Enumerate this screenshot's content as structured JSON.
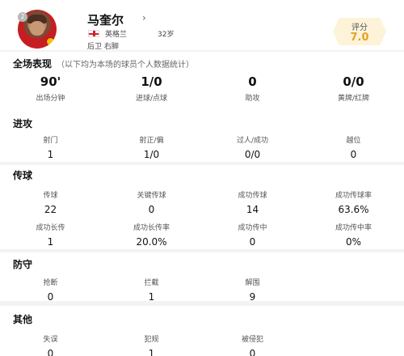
{
  "player": {
    "number": "2",
    "name": "马奎尔",
    "chevron": "›",
    "country": "英格兰",
    "age": "32岁",
    "position": "后卫  右脚",
    "rating_label": "评分",
    "rating_value": "7.0"
  },
  "summary": {
    "title": "全场表现",
    "note": "（以下均为本场的球员个人数据统计）",
    "items": [
      {
        "value": "90'",
        "label": "出场分钟"
      },
      {
        "value": "1/0",
        "label": "进球/点球"
      },
      {
        "value": "0",
        "label": "助攻"
      },
      {
        "value": "0/0",
        "label": "黄牌/红牌"
      }
    ]
  },
  "attack": {
    "title": "进攻",
    "items": [
      {
        "label": "射门",
        "value": "1"
      },
      {
        "label": "射正/偏",
        "value": "1/0"
      },
      {
        "label": "过人/成功",
        "value": "0/0"
      },
      {
        "label": "越位",
        "value": "0"
      }
    ]
  },
  "passing": {
    "title": "传球",
    "row1": [
      {
        "label": "传球",
        "value": "22"
      },
      {
        "label": "关键传球",
        "value": "0"
      },
      {
        "label": "成功传球",
        "value": "14"
      },
      {
        "label": "成功传球率",
        "value": "63.6%"
      }
    ],
    "row2": [
      {
        "label": "成功长传",
        "value": "1"
      },
      {
        "label": "成功长传率",
        "value": "20.0%"
      },
      {
        "label": "成功传中",
        "value": "0"
      },
      {
        "label": "成功传中率",
        "value": "0%"
      }
    ]
  },
  "defense": {
    "title": "防守",
    "items": [
      {
        "label": "抢断",
        "value": "0"
      },
      {
        "label": "拦截",
        "value": "1"
      },
      {
        "label": "解围",
        "value": "9"
      }
    ]
  },
  "other": {
    "title": "其他",
    "items": [
      {
        "label": "失误",
        "value": "0"
      },
      {
        "label": "犯规",
        "value": "1"
      },
      {
        "label": "被侵犯",
        "value": "0"
      }
    ]
  },
  "colors": {
    "rating_bg": "#fdf3d9",
    "rating_text": "#e7a21f",
    "flag_red": "#d21f2b"
  }
}
